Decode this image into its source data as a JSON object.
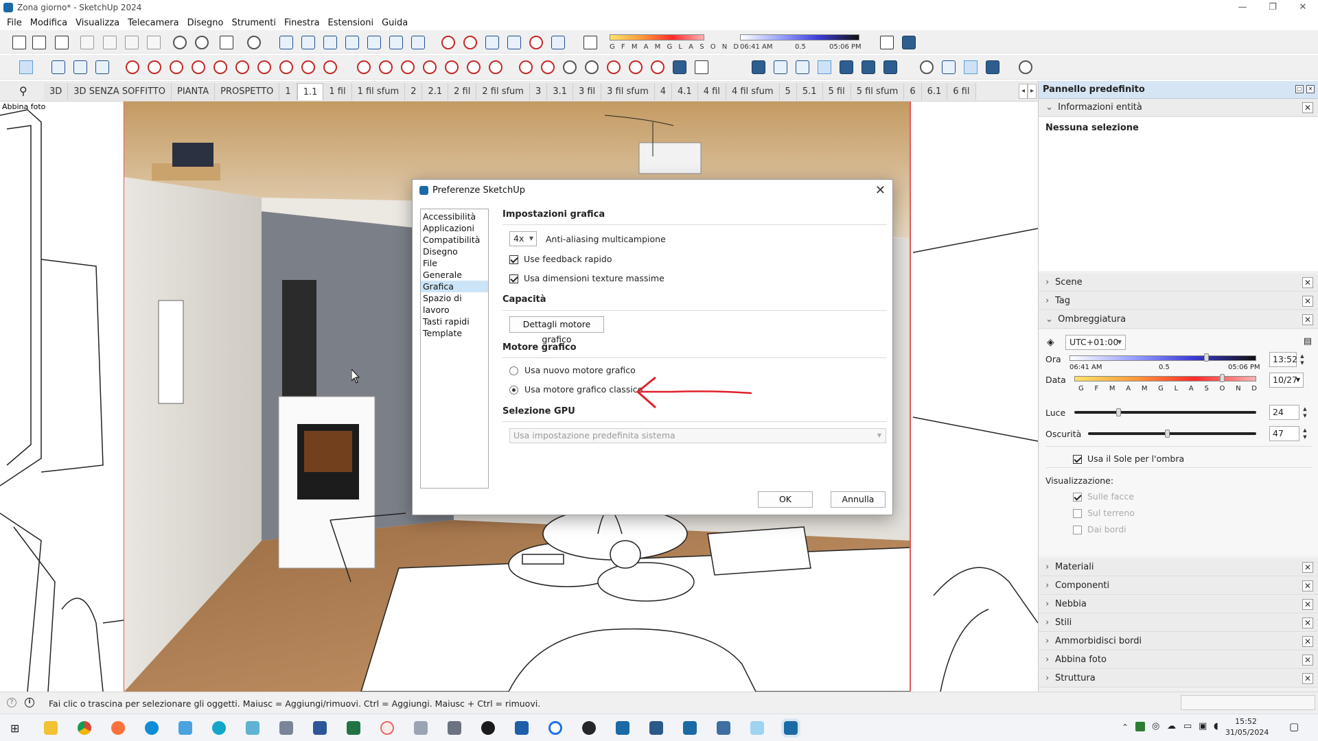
{
  "window": {
    "title": "Zona giorno* - SketchUp 2024",
    "controls": [
      "—",
      "❐",
      "✕"
    ]
  },
  "menu": [
    "File",
    "Modifica",
    "Visualizza",
    "Telecamera",
    "Disegno",
    "Strumenti",
    "Finestra",
    "Estensioni",
    "Guida"
  ],
  "toolbar": {
    "shadow_months": "G F M A M G L A S O N D",
    "time_start": "06:41 AM",
    "time_mid": "0.5",
    "time_end": "05:06 PM"
  },
  "scene_tabs": {
    "items": [
      "3D",
      "3D SENZA SOFFITTO",
      "PIANTA",
      "PROSPETTO",
      "1",
      "1.1",
      "1 fil",
      "1 fil sfum",
      "2",
      "2.1",
      "2 fil",
      "2 fil sfum",
      "3",
      "3.1",
      "3 fil",
      "3 fil sfum",
      "4",
      "4.1",
      "4 fil",
      "4 fil sfum",
      "5",
      "5.1",
      "5 fil",
      "5 fil sfum",
      "6",
      "6.1",
      "6 fil"
    ],
    "active": "1.1",
    "prev": "◂",
    "next": "▸"
  },
  "viewport": {
    "overlay_label": "Abbina foto"
  },
  "dialog": {
    "title": "Preferenze SketchUp",
    "close": "✕",
    "categories": [
      "Accessibilità",
      "Applicazioni",
      "Compatibilità",
      "Disegno",
      "File",
      "Generale",
      "Grafica",
      "Spazio di lavoro",
      "Tasti rapidi",
      "Template"
    ],
    "selected_category": "Grafica",
    "graphics_section": "Impostazioni grafica",
    "antialias_value": "4x",
    "antialias_label": "Anti-aliasing multicampione",
    "fast_feedback_label": "Use feedback rapido",
    "fast_feedback_checked": true,
    "max_texture_label": "Usa dimensioni texture massime",
    "max_texture_checked": true,
    "capacity_section": "Capacità",
    "engine_details_button": "Dettagli motore grafico",
    "engine_section": "Motore grafico",
    "engine_new_label": "Usa nuovo motore grafico",
    "engine_classic_label": "Usa motore grafico classico",
    "engine_selected": "classic",
    "gpu_section": "Selezione GPU",
    "gpu_value": "Usa impostazione predefinita sistema",
    "ok_button": "OK",
    "cancel_button": "Annulla"
  },
  "panel": {
    "title": "Pannello predefinito",
    "entity_info": "Informazioni entità",
    "no_selection": "Nessuna selezione",
    "sections_top": [
      "Scene",
      "Tag"
    ],
    "shadows": {
      "title": "Ombreggiatura",
      "timezone": "UTC+01:00",
      "time_label": "Ora",
      "time_start": "06:41 AM",
      "time_mid": "0.5",
      "time_end": "05:06 PM",
      "time_value": "13:52",
      "date_label": "Data",
      "months": [
        "G",
        "F",
        "M",
        "A",
        "M",
        "G",
        "L",
        "A",
        "S",
        "O",
        "N",
        "D"
      ],
      "date_value": "10/27",
      "light_label": "Luce",
      "light_value": "24",
      "light_fraction": 0.24,
      "dark_label": "Oscurità",
      "dark_value": "47",
      "dark_fraction": 0.47,
      "use_sun_label": "Usa il Sole per l'ombra",
      "display_label": "Visualizzazione:",
      "on_faces": "Sulle facce",
      "on_ground": "Sul terreno",
      "from_edges": "Dai bordi"
    },
    "sections_bottom": [
      "Materiali",
      "Componenti",
      "Nebbia",
      "Stili",
      "Ammorbidisci bordi",
      "Abbina foto",
      "Struttura"
    ]
  },
  "status": {
    "text": "Fai clic o trascina per selezionare gli oggetti. Maiusc = Aggiungi/rimuovi. Ctrl = Aggiungi. Maiusc + Ctrl = rimuovi."
  },
  "taskbar": {
    "time": "15:52",
    "date": "31/05/2024"
  },
  "colors": {
    "accent": "#1a6aa5",
    "annotation_arrow": "#e0202a",
    "panel_header": "#d6e5f3",
    "selection": "#cce4f7"
  }
}
